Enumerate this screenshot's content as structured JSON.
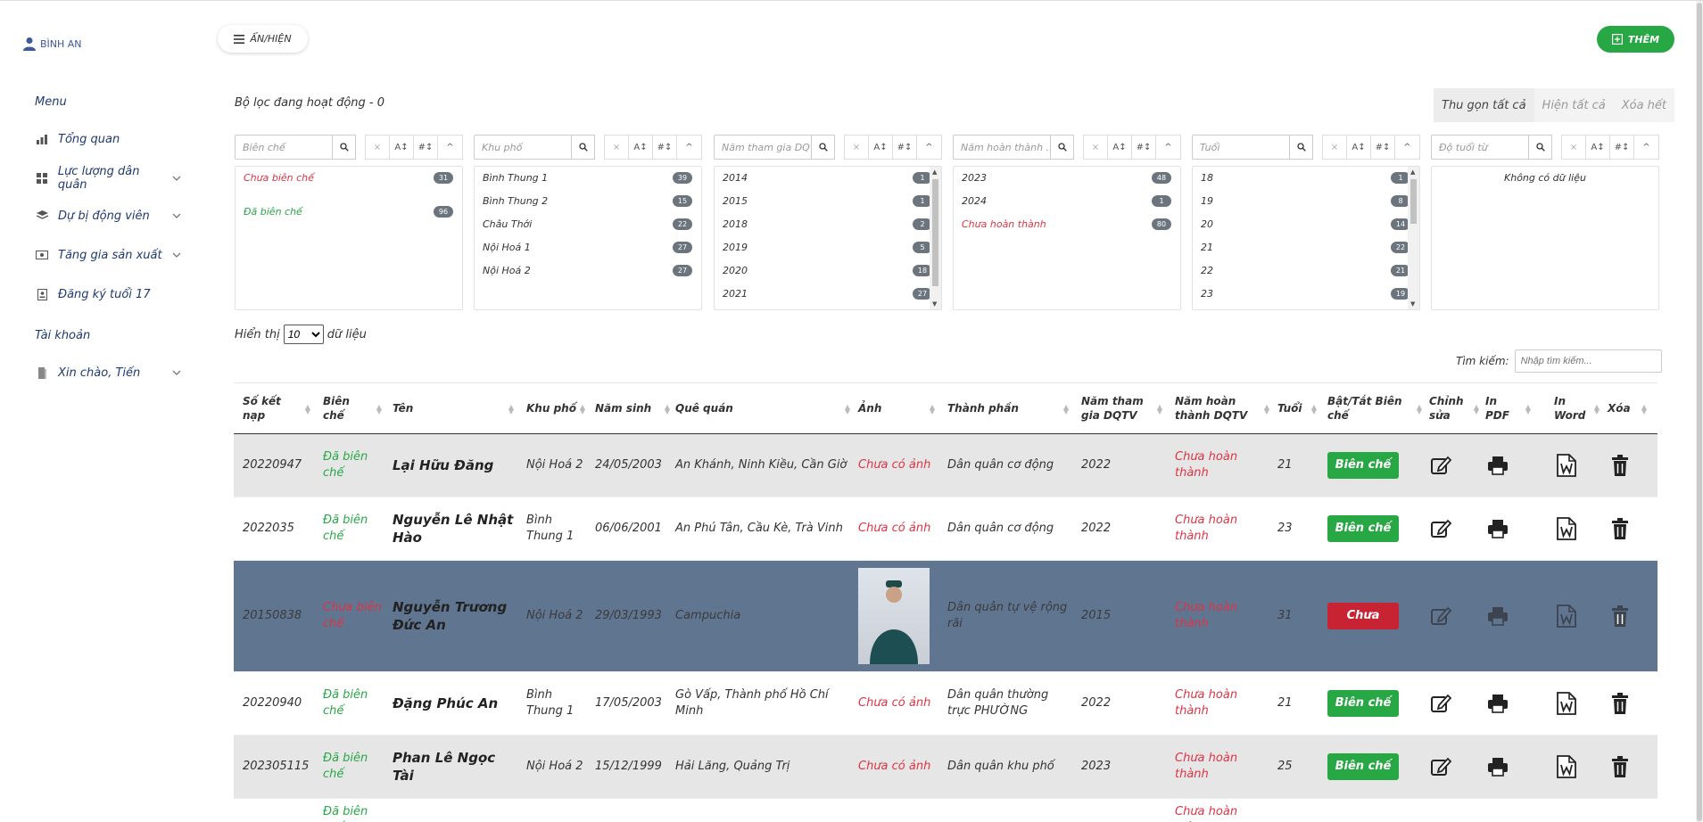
{
  "brand": {
    "user": "BÌNH AN"
  },
  "sidebar": {
    "menu_heading": "Menu",
    "items": [
      {
        "label": "Tổng quan",
        "icon": "bar-chart-icon"
      },
      {
        "label": "Lực lượng dân quân",
        "icon": "grid-icon"
      },
      {
        "label": "Dự bị động viên",
        "icon": "layers-icon"
      },
      {
        "label": "Tăng gia sản xuất",
        "icon": "money-icon"
      },
      {
        "label": "Đăng ký tuổi 17",
        "icon": "id-badge-icon"
      }
    ],
    "account_heading": "Tài khoản",
    "account_item": {
      "label": "Xin chào, Tiến",
      "icon": "user-icon"
    }
  },
  "top": {
    "toggle_label": "ẨN/HIỆN",
    "add_label": "THÊM",
    "filter_status": "Bộ lọc đang hoạt động - 0",
    "collapse_all": "Thu gọn tất cả",
    "show_all": "Hiện tất cả",
    "clear_all": "Xóa hết"
  },
  "filters": [
    {
      "placeholder": "Biên chế",
      "options": [
        {
          "label": "Chưa biên chế",
          "count": "31",
          "color": "#dc3545"
        },
        {
          "label": "Đã biên chế",
          "count": "96",
          "color": "#28a745"
        }
      ]
    },
    {
      "placeholder": "Khu phố",
      "options": [
        {
          "label": "Bình Thung 1",
          "count": "39"
        },
        {
          "label": "Bình Thung 2",
          "count": "15"
        },
        {
          "label": "Châu Thới",
          "count": "22"
        },
        {
          "label": "Nội Hoá 1",
          "count": "27"
        },
        {
          "label": "Nội Hoá 2",
          "count": "27"
        }
      ]
    },
    {
      "placeholder": "Năm tham gia DQ",
      "options": [
        {
          "label": "2014",
          "count": "1"
        },
        {
          "label": "2015",
          "count": "1"
        },
        {
          "label": "2018",
          "count": "2"
        },
        {
          "label": "2019",
          "count": "5"
        },
        {
          "label": "2020",
          "count": "18"
        },
        {
          "label": "2021",
          "count": "27"
        }
      ]
    },
    {
      "placeholder": "Năm hoàn thành ...",
      "options": [
        {
          "label": "2023",
          "count": "48"
        },
        {
          "label": "2024",
          "count": "1"
        },
        {
          "label": "Chưa hoàn thành",
          "count": "80",
          "color": "#dc3545"
        }
      ]
    },
    {
      "placeholder": "Tuổi",
      "options": [
        {
          "label": "18",
          "count": "1"
        },
        {
          "label": "19",
          "count": "8"
        },
        {
          "label": "20",
          "count": "14"
        },
        {
          "label": "21",
          "count": "22"
        },
        {
          "label": "22",
          "count": "21"
        },
        {
          "label": "23",
          "count": "19"
        }
      ]
    },
    {
      "placeholder": "Độ tuổi từ",
      "options": [],
      "empty": "Không có dữ liệu"
    }
  ],
  "filter_controls": {
    "clear": "×",
    "sort_alpha": "A↕",
    "sort_num": "#↕",
    "collapse": "^"
  },
  "show_entries": {
    "prefix": "Hiển thị",
    "value": "10",
    "suffix": "dữ liệu"
  },
  "search": {
    "label": "Tìm kiếm:",
    "placeholder": "Nhập tìm kiếm..."
  },
  "table": {
    "headers": [
      "Số kết nạp",
      "Biên chế",
      "Tên",
      "Khu phố",
      "Năm sinh",
      "Quê quán",
      "Ảnh",
      "Thành phần",
      "Năm tham gia DQTV",
      "Năm hoàn thành DQTV",
      "Tuổi",
      "Bật/Tắt Biên chế",
      "Chỉnh sửa",
      "In PDF",
      "In Word",
      "Xóa"
    ],
    "rows": [
      {
        "id": "20220947",
        "status": "Đã biên chế",
        "status_ok": true,
        "name": "Lại Hữu Đăng",
        "area": "Nội Hoá 2",
        "dob": "24/05/2003",
        "hometown": "An Khánh, Ninh Kiều, Cần Giờ",
        "photo": "Chưa có ảnh",
        "has_photo": false,
        "role": "Dân quân cơ động",
        "joined": "2022",
        "done": "Chưa hoàn thành",
        "age": "21",
        "toggle": "Biên chế",
        "bg": "#e6e6e6"
      },
      {
        "id": "2022035",
        "status": "Đã biên chế",
        "status_ok": true,
        "name": "Nguyễn Lê Nhật Hào",
        "area": "Bình Thung 1",
        "dob": "06/06/2001",
        "hometown": "An Phú Tân, Cầu Kè, Trà Vinh",
        "photo": "Chưa có ảnh",
        "has_photo": false,
        "role": "Dân quân cơ động",
        "joined": "2022",
        "done": "Chưa hoàn thành",
        "age": "23",
        "toggle": "Biên chế",
        "bg": "#ffffff"
      },
      {
        "id": "20150838",
        "status": "Chưa biên chế",
        "status_ok": false,
        "name": "Nguyễn Trương Đức An",
        "area": "Nội Hoá 2",
        "dob": "29/03/1993",
        "hometown": "Campuchia",
        "photo": "",
        "has_photo": true,
        "role": "Dân quân tự vệ rộng rãi",
        "joined": "2015",
        "done": "Chưa hoàn thành",
        "age": "31",
        "toggle": "Chưa",
        "bg": "#5f7590"
      },
      {
        "id": "20220940",
        "status": "Đã biên chế",
        "status_ok": true,
        "name": "Đặng Phúc An",
        "area": "Bình Thung 1",
        "dob": "17/05/2003",
        "hometown": "Gò Vấp, Thành phố Hồ Chí Minh",
        "photo": "Chưa có ảnh",
        "has_photo": false,
        "role": "Dân quân thường trực PHƯỜNG",
        "joined": "2022",
        "done": "Chưa hoàn thành",
        "age": "21",
        "toggle": "Biên chế",
        "bg": "#ffffff"
      },
      {
        "id": "202305115",
        "status": "Đã biên chế",
        "status_ok": true,
        "name": "Phan Lê Ngọc Tài",
        "area": "Nội Hoá 2",
        "dob": "15/12/1999",
        "hometown": "Hải Lăng, Quảng Trị",
        "photo": "Chưa có ảnh",
        "has_photo": false,
        "role": "Dân quân khu phố",
        "joined": "2023",
        "done": "Chưa hoàn thành",
        "age": "25",
        "toggle": "Biên chế",
        "bg": "#e6e6e6"
      },
      {
        "id": "",
        "status": "Đã biên chế",
        "status_ok": true,
        "name": "",
        "area": "",
        "dob": "",
        "hometown": "",
        "photo": "",
        "has_photo": false,
        "role": "",
        "joined": "",
        "done": "Chưa hoàn thành",
        "age": "",
        "toggle": "",
        "bg": "#ffffff"
      }
    ]
  }
}
